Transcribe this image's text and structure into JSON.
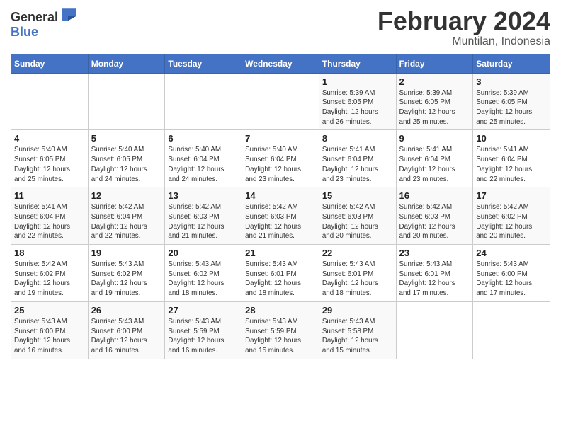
{
  "logo": {
    "general": "General",
    "blue": "Blue"
  },
  "header": {
    "month": "February 2024",
    "location": "Muntilan, Indonesia"
  },
  "weekdays": [
    "Sunday",
    "Monday",
    "Tuesday",
    "Wednesday",
    "Thursday",
    "Friday",
    "Saturday"
  ],
  "weeks": [
    [
      {
        "day": "",
        "info": ""
      },
      {
        "day": "",
        "info": ""
      },
      {
        "day": "",
        "info": ""
      },
      {
        "day": "",
        "info": ""
      },
      {
        "day": "1",
        "info": "Sunrise: 5:39 AM\nSunset: 6:05 PM\nDaylight: 12 hours\nand 26 minutes."
      },
      {
        "day": "2",
        "info": "Sunrise: 5:39 AM\nSunset: 6:05 PM\nDaylight: 12 hours\nand 25 minutes."
      },
      {
        "day": "3",
        "info": "Sunrise: 5:39 AM\nSunset: 6:05 PM\nDaylight: 12 hours\nand 25 minutes."
      }
    ],
    [
      {
        "day": "4",
        "info": "Sunrise: 5:40 AM\nSunset: 6:05 PM\nDaylight: 12 hours\nand 25 minutes."
      },
      {
        "day": "5",
        "info": "Sunrise: 5:40 AM\nSunset: 6:05 PM\nDaylight: 12 hours\nand 24 minutes."
      },
      {
        "day": "6",
        "info": "Sunrise: 5:40 AM\nSunset: 6:04 PM\nDaylight: 12 hours\nand 24 minutes."
      },
      {
        "day": "7",
        "info": "Sunrise: 5:40 AM\nSunset: 6:04 PM\nDaylight: 12 hours\nand 23 minutes."
      },
      {
        "day": "8",
        "info": "Sunrise: 5:41 AM\nSunset: 6:04 PM\nDaylight: 12 hours\nand 23 minutes."
      },
      {
        "day": "9",
        "info": "Sunrise: 5:41 AM\nSunset: 6:04 PM\nDaylight: 12 hours\nand 23 minutes."
      },
      {
        "day": "10",
        "info": "Sunrise: 5:41 AM\nSunset: 6:04 PM\nDaylight: 12 hours\nand 22 minutes."
      }
    ],
    [
      {
        "day": "11",
        "info": "Sunrise: 5:41 AM\nSunset: 6:04 PM\nDaylight: 12 hours\nand 22 minutes."
      },
      {
        "day": "12",
        "info": "Sunrise: 5:42 AM\nSunset: 6:04 PM\nDaylight: 12 hours\nand 22 minutes."
      },
      {
        "day": "13",
        "info": "Sunrise: 5:42 AM\nSunset: 6:03 PM\nDaylight: 12 hours\nand 21 minutes."
      },
      {
        "day": "14",
        "info": "Sunrise: 5:42 AM\nSunset: 6:03 PM\nDaylight: 12 hours\nand 21 minutes."
      },
      {
        "day": "15",
        "info": "Sunrise: 5:42 AM\nSunset: 6:03 PM\nDaylight: 12 hours\nand 20 minutes."
      },
      {
        "day": "16",
        "info": "Sunrise: 5:42 AM\nSunset: 6:03 PM\nDaylight: 12 hours\nand 20 minutes."
      },
      {
        "day": "17",
        "info": "Sunrise: 5:42 AM\nSunset: 6:02 PM\nDaylight: 12 hours\nand 20 minutes."
      }
    ],
    [
      {
        "day": "18",
        "info": "Sunrise: 5:42 AM\nSunset: 6:02 PM\nDaylight: 12 hours\nand 19 minutes."
      },
      {
        "day": "19",
        "info": "Sunrise: 5:43 AM\nSunset: 6:02 PM\nDaylight: 12 hours\nand 19 minutes."
      },
      {
        "day": "20",
        "info": "Sunrise: 5:43 AM\nSunset: 6:02 PM\nDaylight: 12 hours\nand 18 minutes."
      },
      {
        "day": "21",
        "info": "Sunrise: 5:43 AM\nSunset: 6:01 PM\nDaylight: 12 hours\nand 18 minutes."
      },
      {
        "day": "22",
        "info": "Sunrise: 5:43 AM\nSunset: 6:01 PM\nDaylight: 12 hours\nand 18 minutes."
      },
      {
        "day": "23",
        "info": "Sunrise: 5:43 AM\nSunset: 6:01 PM\nDaylight: 12 hours\nand 17 minutes."
      },
      {
        "day": "24",
        "info": "Sunrise: 5:43 AM\nSunset: 6:00 PM\nDaylight: 12 hours\nand 17 minutes."
      }
    ],
    [
      {
        "day": "25",
        "info": "Sunrise: 5:43 AM\nSunset: 6:00 PM\nDaylight: 12 hours\nand 16 minutes."
      },
      {
        "day": "26",
        "info": "Sunrise: 5:43 AM\nSunset: 6:00 PM\nDaylight: 12 hours\nand 16 minutes."
      },
      {
        "day": "27",
        "info": "Sunrise: 5:43 AM\nSunset: 5:59 PM\nDaylight: 12 hours\nand 16 minutes."
      },
      {
        "day": "28",
        "info": "Sunrise: 5:43 AM\nSunset: 5:59 PM\nDaylight: 12 hours\nand 15 minutes."
      },
      {
        "day": "29",
        "info": "Sunrise: 5:43 AM\nSunset: 5:58 PM\nDaylight: 12 hours\nand 15 minutes."
      },
      {
        "day": "",
        "info": ""
      },
      {
        "day": "",
        "info": ""
      }
    ]
  ]
}
